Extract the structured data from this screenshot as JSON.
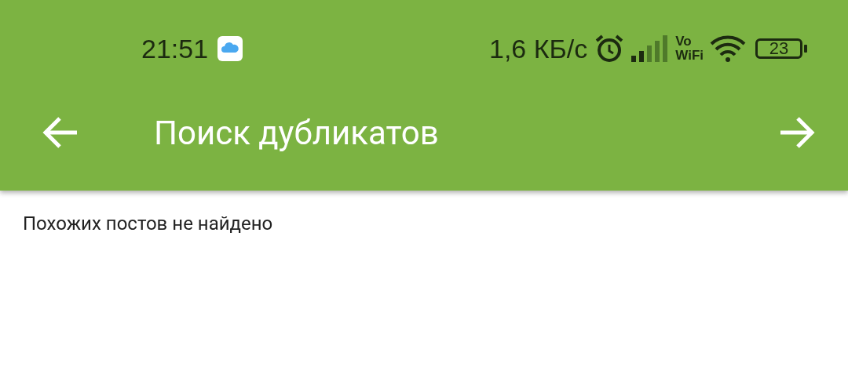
{
  "status_bar": {
    "time": "21:51",
    "network_speed": "1,6 КБ/с",
    "vowifi_top": "Vo",
    "vowifi_bottom": "WiFi",
    "battery": "23"
  },
  "toolbar": {
    "title": "Поиск дубликатов"
  },
  "content": {
    "message": "Похожих постов не найдено"
  }
}
